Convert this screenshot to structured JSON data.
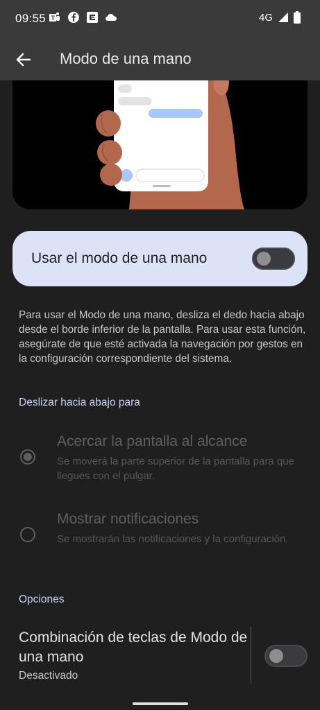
{
  "status_bar": {
    "time": "09:55",
    "left_icons": [
      "teams-icon",
      "facebook-icon",
      "app-icon",
      "cloud-icon"
    ],
    "network": "4G",
    "right_icons": [
      "signal-icon",
      "battery-icon"
    ]
  },
  "app_bar": {
    "title": "Modo de una mano",
    "back_icon": "back-arrow-icon"
  },
  "main_toggle": {
    "label": "Usar el modo de una mano",
    "enabled": false
  },
  "description": "Para usar el Modo de una mano, desliza el dedo hacia abajo desde el borde inferior de la pantalla. Para usar esta función, asegúrate de que esté activada la navegación por gestos en la configuración correspondiente del sistema.",
  "swipe_section": {
    "header": "Deslizar hacia abajo para",
    "options": [
      {
        "title": "Acercar la pantalla al alcance",
        "subtitle": "Se moverá la parte superior de la pantalla para que llegues con el pulgar.",
        "selected": true
      },
      {
        "title": "Mostrar notificaciones",
        "subtitle": "Se mostrarán las notificaciones y la configuración.",
        "selected": false
      }
    ]
  },
  "options_section": {
    "header": "Opciones",
    "shortcut": {
      "title": "Combinación de teclas de Modo de una mano",
      "subtitle": "Desactivado",
      "enabled": false
    }
  },
  "colors": {
    "background": "#1f1f1f",
    "app_bar": "#3a3a3a",
    "toggle_card": "#dde3f7",
    "section_header": "#c9d6f3",
    "skin": "#b3684d",
    "accent_blue": "#a8c7fa"
  }
}
